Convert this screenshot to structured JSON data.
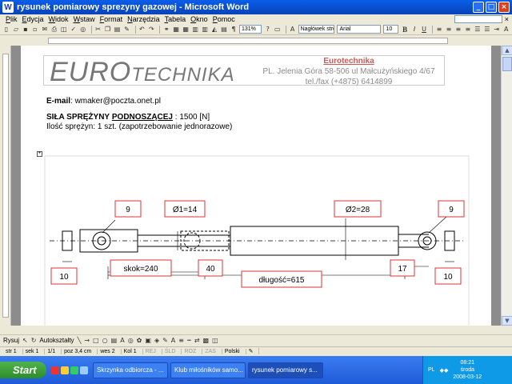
{
  "window": {
    "title": "rysunek pomiarowy sprezyny gazowej - Microsoft Word",
    "app_icon": "W"
  },
  "menu": {
    "items": [
      "Plik",
      "Edycja",
      "Widok",
      "Wstaw",
      "Format",
      "Narzędzia",
      "Tabela",
      "Okno",
      "Pomoc"
    ]
  },
  "toolbar": {
    "zoom": "131%",
    "style": "Nagłówek stron",
    "font": "Arial",
    "size": "10",
    "bold": "B",
    "italic": "I",
    "underline": "U"
  },
  "header": {
    "logo_euro": "EURO",
    "logo_technika": "TECHNIKA",
    "company_name": "Eurotechnika",
    "address": "PL. Jelenia Góra 58-506 ul Małcużyńskiego 4/67",
    "phone": "tel./fax (+4875) 6414899"
  },
  "body": {
    "email_label": "E-mail",
    "email_value": ": wmaker@poczta.onet.pl",
    "force_label_a": "SIŁA SPRĘŻYNY",
    "force_label_b": "PODNOSZĄCEJ",
    "force_value": ": 1500 [N]",
    "quantity": "Ilość sprężyn:    1 szt. (zapotrzebowanie jednorazowe)"
  },
  "drawing": {
    "dim_left_eye": "9",
    "dim_rod": "Ø1=14",
    "dim_body": "Ø2=28",
    "dim_right_eye": "9",
    "dim_left_width": "10",
    "dim_stroke": "skok=240",
    "dim_40": "40",
    "dim_length": "długość=615",
    "dim_17": "17",
    "dim_right_width": "10"
  },
  "drawbar": {
    "draw": "Rysuj",
    "autoshapes": "Autokształty"
  },
  "status": {
    "page": "str 1",
    "section": "sek 1",
    "pages": "1/1",
    "pos": "poz 3,4 cm",
    "line": "wes 2",
    "col": "Kol 1",
    "rec": "REJ",
    "trk": "ŚLD",
    "ext": "ROZ",
    "ovr": "ZAS",
    "lang": "Polski"
  },
  "taskbar": {
    "start": "Start",
    "tasks": [
      "Skrzynka odbiorcza - ...",
      "Klub miłośników samo...",
      "rysunek pomiarowy s..."
    ],
    "lang": "PL",
    "time": "08:21",
    "day": "środa",
    "date": "2008-03-12"
  }
}
